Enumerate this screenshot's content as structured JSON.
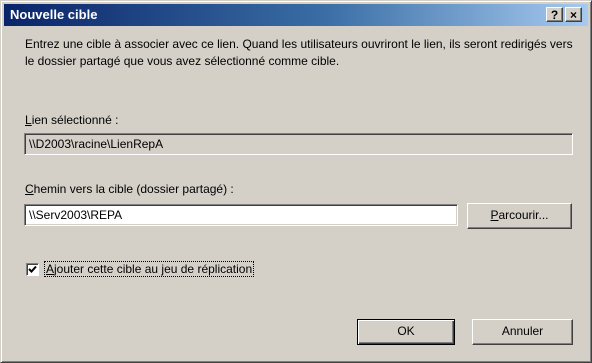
{
  "dialog": {
    "title": "Nouvelle cible",
    "help_symbol": "?",
    "close_symbol": "×"
  },
  "description": "Entrez une cible à associer avec ce lien. Quand les utilisateurs ouvriront le lien, ils seront redirigés vers le dossier partagé que vous avez sélectionné comme cible.",
  "selected_link": {
    "label_accel": "L",
    "label_rest": "ien sélectionné :",
    "value": "\\\\D2003\\racine\\LienRepA"
  },
  "target_path": {
    "label_accel": "C",
    "label_rest": "hemin vers la cible (dossier partagé) :",
    "value": "\\\\Serv2003\\REPA"
  },
  "browse_button": {
    "label_accel": "P",
    "label_rest": "arcourir..."
  },
  "replication": {
    "checked": true,
    "label_accel": "A",
    "label_rest": "jouter cette cible au jeu de réplication"
  },
  "buttons": {
    "ok": "OK",
    "cancel": "Annuler"
  }
}
